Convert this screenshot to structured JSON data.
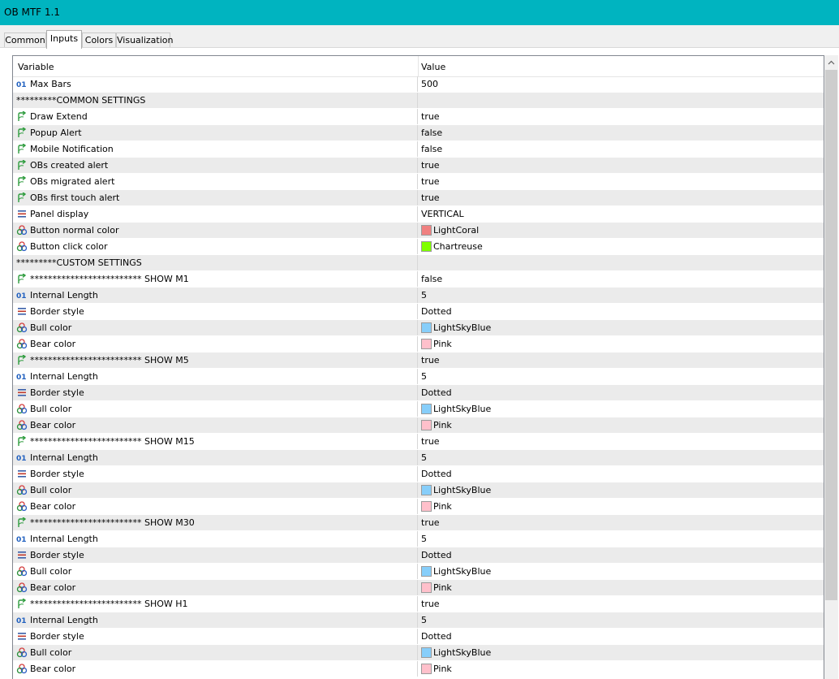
{
  "window": {
    "title": "OB MTF 1.1",
    "title_bar_color": "#00b4c0"
  },
  "tabs": [
    {
      "label": "Common",
      "active": false
    },
    {
      "label": "Inputs",
      "active": true
    },
    {
      "label": "Colors",
      "active": false
    },
    {
      "label": "Visualization",
      "active": false
    }
  ],
  "grid": {
    "columns": [
      "Variable",
      "Value"
    ],
    "rows": [
      {
        "icon": "int",
        "variable": "Max Bars",
        "value": "500"
      },
      {
        "icon": "none",
        "variable": "*********COMMON SETTINGS",
        "value": "",
        "section": true
      },
      {
        "icon": "bool",
        "variable": "Draw Extend",
        "value": "true"
      },
      {
        "icon": "bool",
        "variable": "Popup Alert",
        "value": "false"
      },
      {
        "icon": "bool",
        "variable": "Mobile Notification",
        "value": "false"
      },
      {
        "icon": "bool",
        "variable": "OBs created alert",
        "value": "true"
      },
      {
        "icon": "bool",
        "variable": "OBs migrated alert",
        "value": "true"
      },
      {
        "icon": "bool",
        "variable": "OBs first touch alert",
        "value": "true"
      },
      {
        "icon": "enum",
        "variable": "Panel display",
        "value": "VERTICAL"
      },
      {
        "icon": "color",
        "variable": "Button normal color",
        "value": "LightCoral",
        "swatch": "#f08080"
      },
      {
        "icon": "color",
        "variable": "Button click color",
        "value": "Chartreuse",
        "swatch": "#7fff00"
      },
      {
        "icon": "none",
        "variable": "*********CUSTOM SETTINGS",
        "value": "",
        "section": true
      },
      {
        "icon": "bool",
        "variable": "************************* SHOW M1",
        "value": "false"
      },
      {
        "icon": "int",
        "variable": "Internal Length",
        "value": "5"
      },
      {
        "icon": "enum",
        "variable": "Border style",
        "value": "Dotted"
      },
      {
        "icon": "color",
        "variable": "Bull color",
        "value": "LightSkyBlue",
        "swatch": "#87cefa"
      },
      {
        "icon": "color",
        "variable": "Bear color",
        "value": "Pink",
        "swatch": "#ffc0cb"
      },
      {
        "icon": "bool",
        "variable": "************************* SHOW M5",
        "value": "true"
      },
      {
        "icon": "int",
        "variable": "Internal Length",
        "value": "5"
      },
      {
        "icon": "enum",
        "variable": "Border style",
        "value": "Dotted"
      },
      {
        "icon": "color",
        "variable": "Bull color",
        "value": "LightSkyBlue",
        "swatch": "#87cefa"
      },
      {
        "icon": "color",
        "variable": "Bear color",
        "value": "Pink",
        "swatch": "#ffc0cb"
      },
      {
        "icon": "bool",
        "variable": "************************* SHOW M15",
        "value": "true"
      },
      {
        "icon": "int",
        "variable": "Internal Length",
        "value": "5"
      },
      {
        "icon": "enum",
        "variable": "Border style",
        "value": "Dotted"
      },
      {
        "icon": "color",
        "variable": "Bull color",
        "value": "LightSkyBlue",
        "swatch": "#87cefa"
      },
      {
        "icon": "color",
        "variable": "Bear color",
        "value": "Pink",
        "swatch": "#ffc0cb"
      },
      {
        "icon": "bool",
        "variable": "************************* SHOW M30",
        "value": "true"
      },
      {
        "icon": "int",
        "variable": "Internal Length",
        "value": "5"
      },
      {
        "icon": "enum",
        "variable": "Border style",
        "value": "Dotted"
      },
      {
        "icon": "color",
        "variable": "Bull color",
        "value": "LightSkyBlue",
        "swatch": "#87cefa"
      },
      {
        "icon": "color",
        "variable": "Bear color",
        "value": "Pink",
        "swatch": "#ffc0cb"
      },
      {
        "icon": "bool",
        "variable": "************************* SHOW H1",
        "value": "true"
      },
      {
        "icon": "int",
        "variable": "Internal Length",
        "value": "5"
      },
      {
        "icon": "enum",
        "variable": "Border style",
        "value": "Dotted"
      },
      {
        "icon": "color",
        "variable": "Bull color",
        "value": "LightSkyBlue",
        "swatch": "#87cefa"
      },
      {
        "icon": "color",
        "variable": "Bear color",
        "value": "Pink",
        "swatch": "#ffc0cb"
      }
    ]
  }
}
